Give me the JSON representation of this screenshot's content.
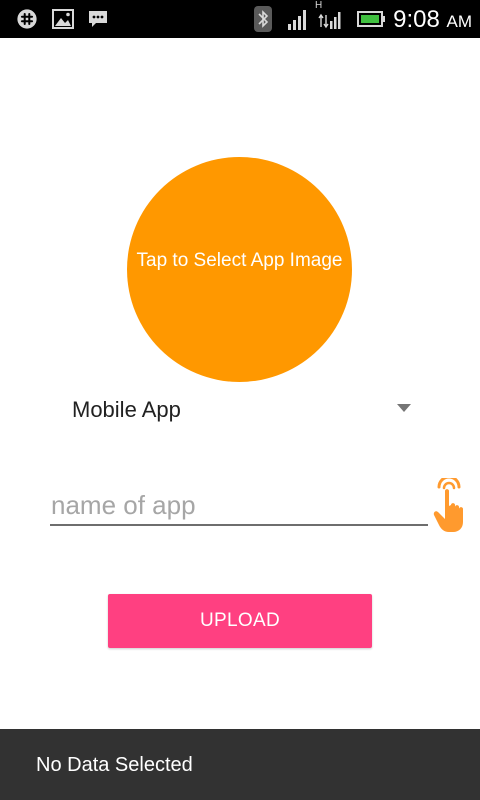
{
  "status_bar": {
    "time": "9:08",
    "ampm": "AM",
    "network_type": "H",
    "icons": [
      "slack-icon",
      "gallery-icon",
      "message-icon",
      "bluetooth-icon",
      "signal-icon",
      "signal-icon",
      "battery-icon"
    ]
  },
  "circle": {
    "label": "Tap to Select App Image",
    "color": "#ff9800"
  },
  "spinner": {
    "selected": "Mobile App"
  },
  "app_name": {
    "placeholder": "name of app",
    "value": ""
  },
  "upload": {
    "label": "UPLOAD",
    "color": "#ff4081"
  },
  "snackbar": {
    "message": "No Data Selected"
  }
}
